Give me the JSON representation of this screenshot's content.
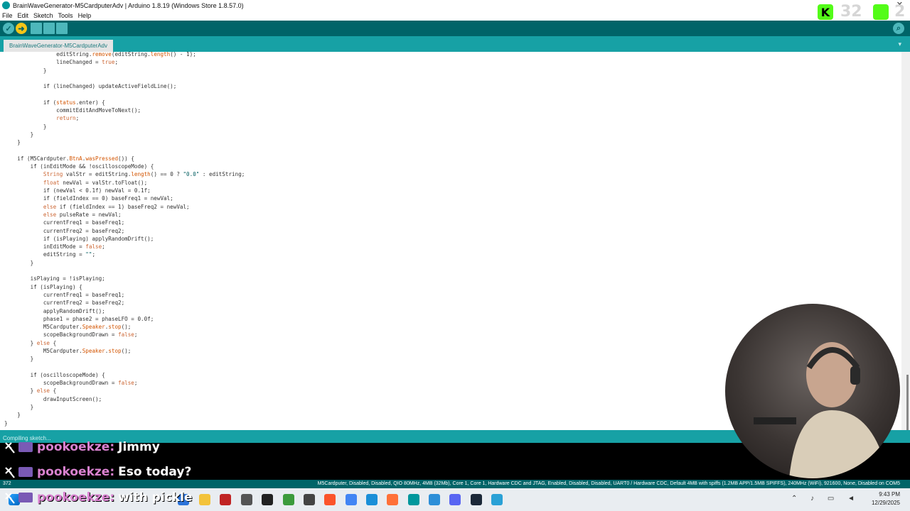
{
  "window": {
    "title": "BrainWaveGenerator-M5CardputerAdv | Arduino 1.8.19 (Windows Store 1.8.57.0)",
    "close_label": "✕"
  },
  "menu": {
    "items": [
      "File",
      "Edit",
      "Sketch",
      "Tools",
      "Help"
    ]
  },
  "toolbar": {
    "verify": "✓",
    "upload": "➜",
    "new": "",
    "open": "",
    "save": "",
    "serial": "⌕"
  },
  "tabs": {
    "active": "BrainWaveGenerator-M5CardputerAdv",
    "menu_icon": "▾"
  },
  "console": {
    "status_text": "Compiling sketch..."
  },
  "statusbar": {
    "line_number": "372",
    "board_info": "M5Cardputer, Disabled, Disabled, QIO 80MHz, 4MB (32Mb), Core 1, Core 1, Hardware CDC and JTAG, Enabled, Disabled, Disabled, UART0 / Hardware CDC, Default 4MB with spiffs (1.2MB APP/1.5MB SPIFFS), 240MHz (WiFi), 921600, None, Disabled on COM5"
  },
  "chat": [
    {
      "user": "pookoekze:",
      "message": "Jimmy"
    },
    {
      "user": "pookoekze:",
      "message": "Eso today?"
    },
    {
      "user": "pookoekze:",
      "message": "with pickle"
    }
  ],
  "overlay": {
    "kick_letter": "K",
    "count_left": "32",
    "count_right": "2"
  },
  "taskbar": {
    "time": "9:43 PM",
    "date": "12/29/2025"
  },
  "colors": {
    "toolbar": "#006468",
    "tabbar": "#17a1a5",
    "chat_user": "#d982d0",
    "accent_green": "#53fc18"
  }
}
